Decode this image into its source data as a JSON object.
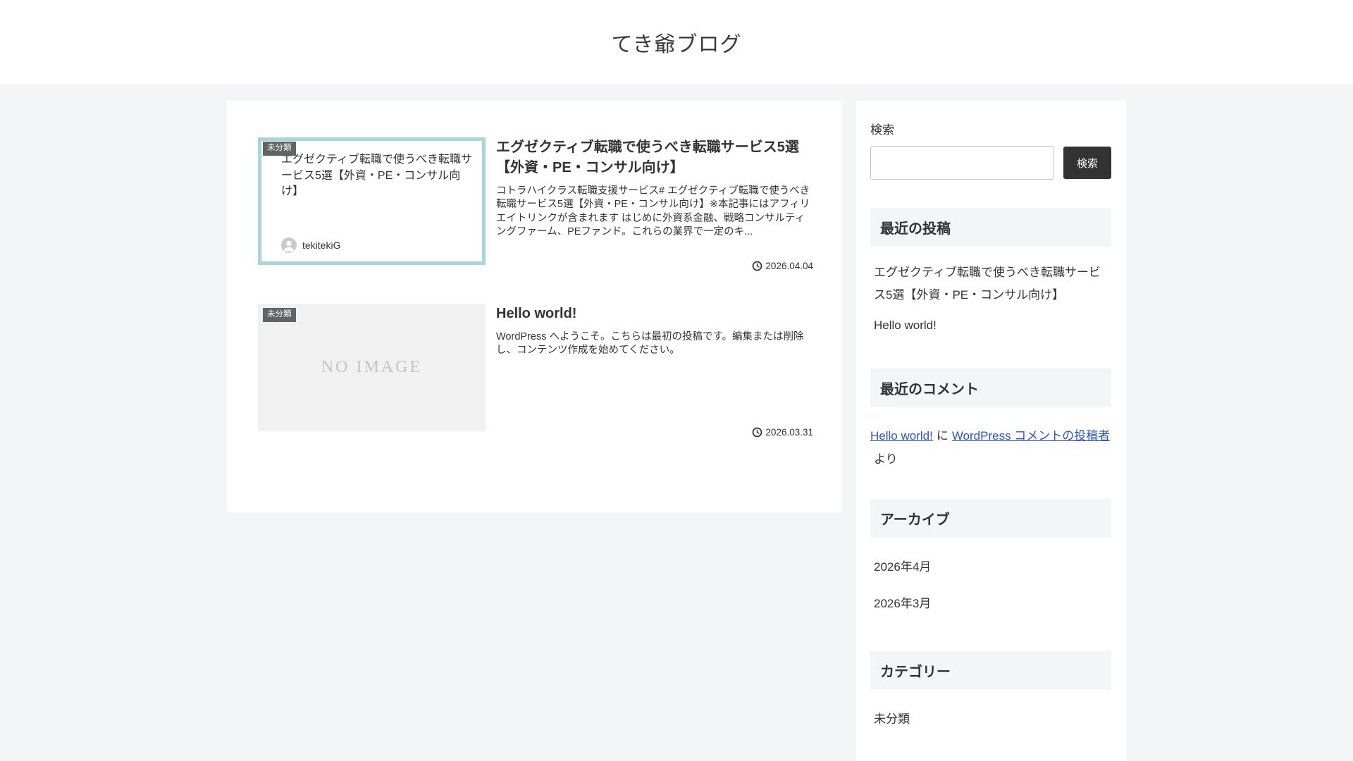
{
  "site": {
    "title": "てき爺ブログ"
  },
  "main": {
    "posts": [
      {
        "category": "未分類",
        "title": "エグゼクティブ転職で使うべき転職サービス5選【外資・PE・コンサル向け】",
        "excerpt": "コトラハイクラス転職支援サービス# エグゼクティブ転職で使うべき転職サービス5選【外資・PE・コンサル向け】※本記事にはアフィリエイトリンクが含まれます はじめに外資系金融、戦略コンサルティングファーム、PEファンド。これらの業界で一定のキ...",
        "date": "2026.04.04",
        "thumbnail": {
          "type": "card",
          "title": "エグゼクティブ転職で使うべき転職サービス5選【外資・PE・コンサル向け】",
          "author": "tekitekiG"
        }
      },
      {
        "category": "未分類",
        "title": "Hello world!",
        "excerpt": "WordPress へようこそ。こちらは最初の投稿です。編集または削除し、コンテンツ作成を始めてください。",
        "date": "2026.03.31",
        "thumbnail": {
          "type": "noimage",
          "label": "NO IMAGE"
        }
      }
    ]
  },
  "sidebar": {
    "search": {
      "label": "検索",
      "button_label": "検索",
      "value": ""
    },
    "recent_posts": {
      "heading": "最近の投稿",
      "items": [
        "エグゼクティブ転職で使うべき転職サービス5選【外資・PE・コンサル向け】",
        "Hello world!"
      ]
    },
    "recent_comments": {
      "heading": "最近のコメント",
      "items": [
        {
          "post": "Hello world!",
          "connector": "に",
          "author": "WordPress コメントの投稿者",
          "suffix": "より"
        }
      ]
    },
    "archives": {
      "heading": "アーカイブ",
      "items": [
        "2026年4月",
        "2026年3月"
      ]
    },
    "categories": {
      "heading": "カテゴリー",
      "items": [
        "未分類"
      ]
    }
  },
  "colors": {
    "background": "#f4f5f6",
    "accent_teal": "#a9d6da",
    "badge_bg": "#616365",
    "button_bg": "#333333",
    "link_blue": "#2b54c8",
    "noimage_bg": "#f1f1f2",
    "noimage_text": "#c4c4c4"
  }
}
